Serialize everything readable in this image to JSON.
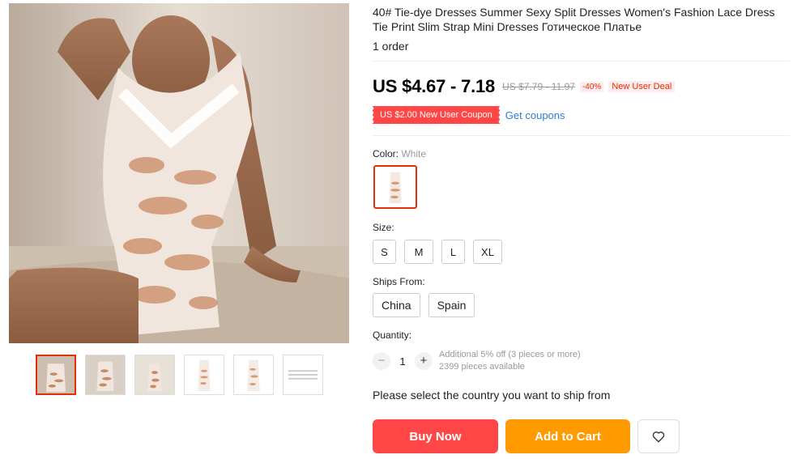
{
  "product": {
    "title": "40# Tie-dye Dresses Summer Sexy Split Dresses Women's Fashion Lace Dress Tie Print Slim Strap Mini Dresses Готическое Платье",
    "orders": "1 order"
  },
  "pricing": {
    "price": "US $4.67 - 7.18",
    "original_price": "US $7.79 - 11.97",
    "discount": "-40%",
    "deal_badge": "New User Deal",
    "coupon": "US $2.00 New User Coupon",
    "get_coupons": "Get coupons"
  },
  "color": {
    "label": "Color:",
    "selected": "White"
  },
  "size": {
    "label": "Size:",
    "options": [
      "S",
      "M",
      "L",
      "XL"
    ]
  },
  "ships_from": {
    "label": "Ships From:",
    "options": [
      "China",
      "Spain"
    ]
  },
  "quantity": {
    "label": "Quantity:",
    "minus": "−",
    "plus": "+",
    "value": "1",
    "discount_note": "Additional 5% off (3 pieces or more)",
    "available": "2399 pieces available"
  },
  "ship_note": "Please select the country you want to ship from",
  "actions": {
    "buy_now": "Buy Now",
    "add_to_cart": "Add to Cart",
    "wishlist_icon": "heart-icon"
  },
  "colors": {
    "accent": "#ff4747",
    "cart": "#ff9a00",
    "link": "#2e7dd6",
    "selected_border": "#e62e04"
  }
}
